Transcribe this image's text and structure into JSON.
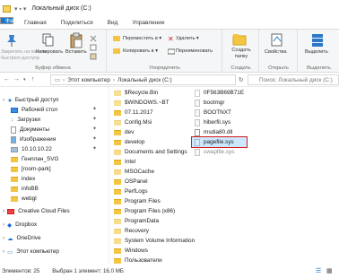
{
  "window": {
    "title": "Локальный диск (C:)"
  },
  "tabs": [
    "Файл",
    "Главная",
    "Поделиться",
    "Вид",
    "Управление"
  ],
  "ribbon": {
    "clipboard": {
      "group": "Буфер обмена",
      "pin": "Закрепить на панели\nбыстрого доступа",
      "copy": "Копировать",
      "paste": "Вставить"
    },
    "organize": {
      "group": "Упорядочить",
      "move": "Переместить в ▾",
      "copy_to": "Копировать в ▾",
      "delete": "Удалить ▾",
      "rename": "Переименовать"
    },
    "new": {
      "group": "Создать",
      "new_folder": "Создать\nпапку"
    },
    "open": {
      "group": "Открыть",
      "properties": "Свойства"
    },
    "select": {
      "group": "Выделить",
      "select": "Выделить"
    }
  },
  "address": {
    "path_this_pc": "Этот компьютер",
    "path_disk": "Локальный диск (C:)",
    "search_placeholder": "Поиск: Локальный диск (C:)"
  },
  "nav": [
    "Быстрый доступ",
    "Рабочий стол",
    "Загрузки",
    "Документы",
    "Изображения",
    "10.10.10.22",
    "Генплан_SVG",
    "[room-park]",
    "index",
    "infoBB",
    "webgl",
    "Creative Cloud Files",
    "Dropbox",
    "OneDrive",
    "Этот компьютер"
  ],
  "files_col1": [
    "$Recycle.Bin",
    "$WINDOWS.~BT",
    "07.11.2017",
    "Config.Msi",
    "dev",
    "develop",
    "Documents and Settings",
    "Intel",
    "MSOCache",
    "OSPanel",
    "PerfLogs",
    "Program Files",
    "Program Files (x86)",
    "ProgramData",
    "Recovery",
    "System Volume Information",
    "Windows",
    "Пользователи"
  ],
  "files_col2": [
    "0F563B69B71E",
    "bootmgr",
    "BOOTNXT",
    "hiberfil.sys",
    "msdia80.dll",
    "pagefile.sys",
    "swapfile.sys"
  ],
  "status": {
    "count": "Элементов: 25",
    "selected": "Выбран 1 элемент: 16,0 МБ"
  }
}
